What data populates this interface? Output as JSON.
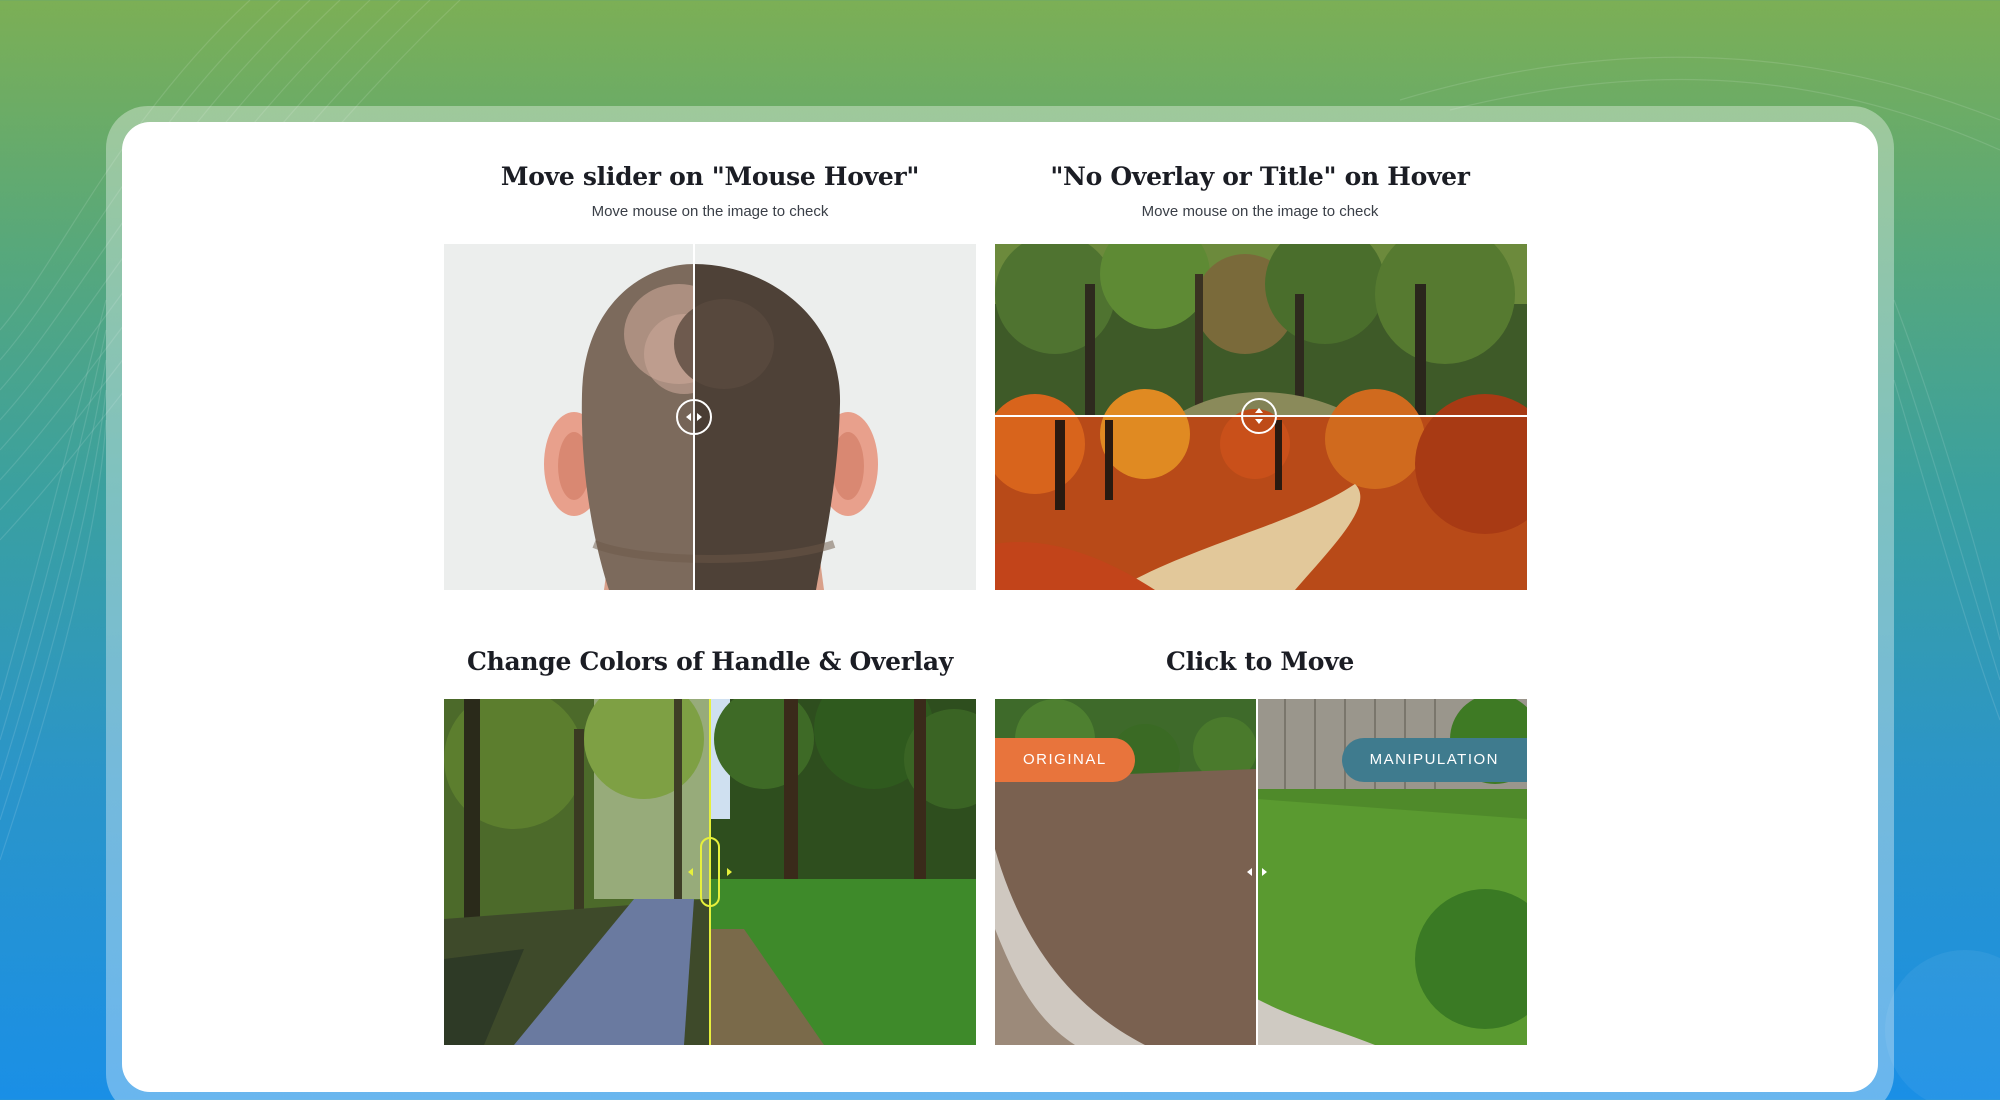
{
  "colors": {
    "card_bg": "#ffffff",
    "divider": "#ffffff",
    "handle_accent": "#e6f03c",
    "tag_original_bg": "#e8743c",
    "tag_manipulation_bg": "#3f7b8e"
  },
  "demos": [
    {
      "title": "Move slider on \"Mouse Hover\"",
      "subtitle": "Move mouse on the image to check",
      "orientation": "horizontal",
      "handle_icon": "left-right-arrows-icon",
      "slider_position": 0.47
    },
    {
      "title": "\"No Overlay or Title\" on Hover",
      "subtitle": "Move mouse on the image to check",
      "orientation": "vertical",
      "handle_icon": "up-down-arrows-icon",
      "slider_position": 0.5
    },
    {
      "title": "Change Colors of Handle & Overlay",
      "orientation": "horizontal",
      "handle_icon": "pill-handle-icon",
      "slider_position": 0.5
    },
    {
      "title": "Click to Move",
      "orientation": "horizontal",
      "handle_icon": "small-arrows-icon",
      "slider_position": 0.49,
      "before_label": "ORIGINAL",
      "after_label": "MANIPULATION"
    }
  ]
}
